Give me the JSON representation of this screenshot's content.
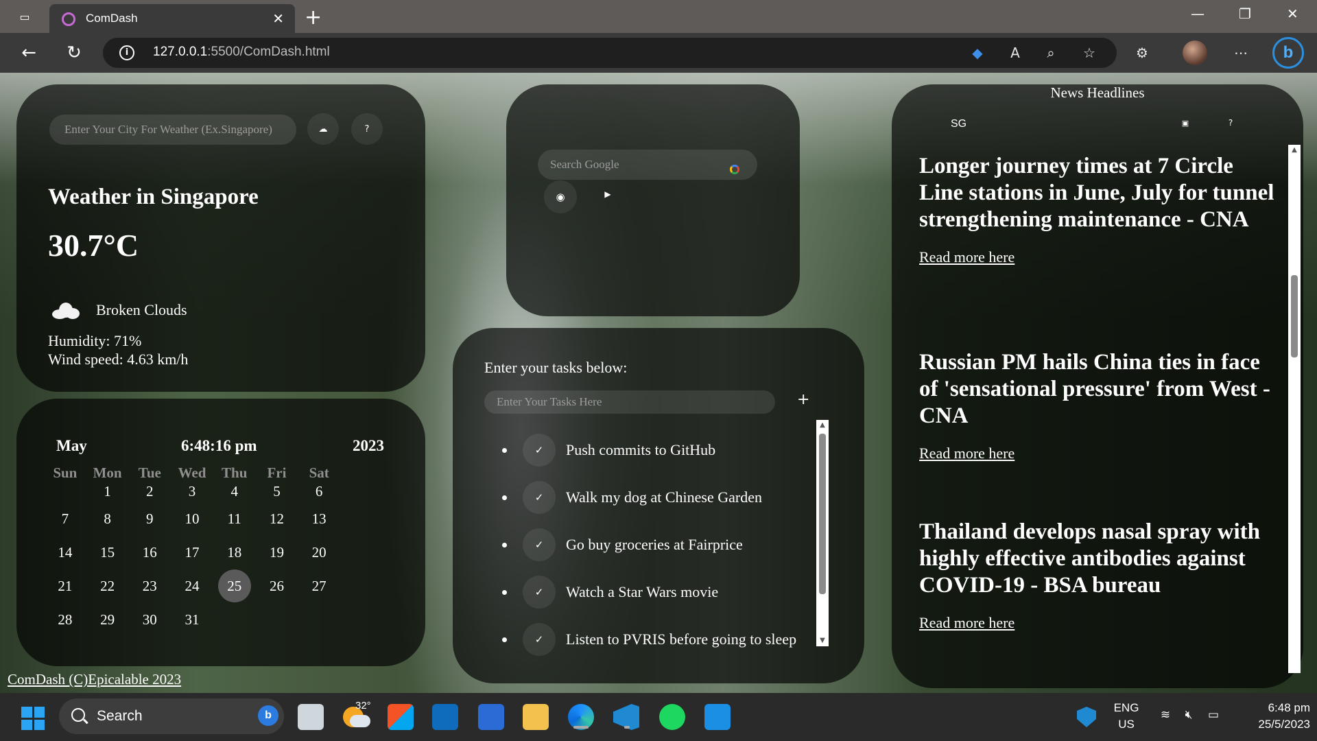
{
  "browser": {
    "tab_title": "ComDash",
    "url_host": "127.0.0.1",
    "url_path": ":5500/ComDash.html"
  },
  "weather": {
    "city_placeholder": "Enter Your City For Weather (Ex.Singapore)",
    "title": "Weather in Singapore",
    "temperature": "30.7°C",
    "description": "Broken Clouds",
    "humidity": "Humidity: 71%",
    "wind": "Wind speed: 4.63 km/h"
  },
  "google": {
    "search_placeholder": "Search Google"
  },
  "calendar": {
    "month": "May",
    "time": "6:48:16 pm",
    "year": "2023",
    "weekdays": [
      "Sun",
      "Mon",
      "Tue",
      "Wed",
      "Thu",
      "Fri",
      "Sat"
    ],
    "weeks": [
      [
        "",
        "1",
        "2",
        "3",
        "4",
        "5",
        "6"
      ],
      [
        "7",
        "8",
        "9",
        "10",
        "11",
        "12",
        "13"
      ],
      [
        "14",
        "15",
        "16",
        "17",
        "18",
        "19",
        "20"
      ],
      [
        "21",
        "22",
        "23",
        "24",
        "25",
        "26",
        "27"
      ],
      [
        "28",
        "29",
        "30",
        "31",
        "",
        "",
        ""
      ]
    ],
    "today": "25"
  },
  "tasks": {
    "label": "Enter your tasks below:",
    "input_placeholder": "Enter Your Tasks Here",
    "add_symbol": "+",
    "items": [
      "Push commits to GitHub",
      "Walk my dog at Chinese Garden",
      "Go buy groceries at Fairprice",
      "Watch a Star Wars movie",
      "Listen to PVRIS before going to sleep"
    ]
  },
  "news": {
    "heading": "News Headlines",
    "country": "SG",
    "articles": [
      {
        "title": "Longer journey times at 7 Circle Line stations in June, July for tunnel strengthening maintenance - CNA",
        "link": "Read more here"
      },
      {
        "title": "Russian PM hails China ties in face of 'sensational pressure' from West - CNA",
        "link": "Read more here"
      },
      {
        "title": "Thailand develops nasal spray with highly effective antibodies against COVID-19 - BSA bureau",
        "link": "Read more here"
      }
    ]
  },
  "footer": {
    "text": "ComDash (C)Epicalable 2023"
  },
  "taskbar": {
    "search_label": "Search",
    "weather_temp": "32°",
    "lang_1": "ENG",
    "lang_2": "US",
    "time": "6:48 pm",
    "date": "25/5/2023"
  }
}
